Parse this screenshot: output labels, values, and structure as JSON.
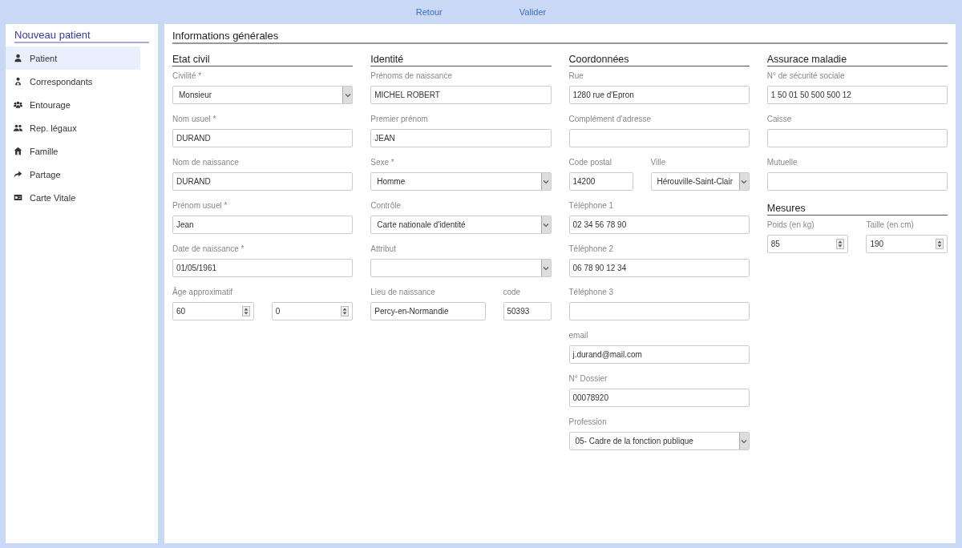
{
  "toolbar": {
    "actions": [
      "Retour",
      "Valider"
    ]
  },
  "sidebar": {
    "title": "Nouveau patient",
    "items": [
      {
        "label": "Patient",
        "kind": "person",
        "selected": true
      },
      {
        "label": "Correspondants",
        "kind": "doctor",
        "selected": false
      },
      {
        "label": "Entourage",
        "kind": "group",
        "selected": false
      },
      {
        "label": "Rep. légaux",
        "kind": "pair",
        "selected": false
      },
      {
        "label": "Famille",
        "kind": "house",
        "selected": false
      },
      {
        "label": "Partage",
        "kind": "share",
        "selected": false
      },
      {
        "label": "Carte Vitale",
        "kind": "card",
        "selected": false
      }
    ]
  },
  "main": {
    "title": "Informations générales",
    "columns": [
      {
        "sections": [
          {
            "title": "Etat civil",
            "rows": [
              [
                {
                  "kind": "select",
                  "label": "Civilité *",
                  "value": "Monsieur"
                }
              ],
              [
                {
                  "kind": "text",
                  "label": "Nom usuel *",
                  "value": "DURAND"
                }
              ],
              [
                {
                  "kind": "text",
                  "label": "Nom de naissance",
                  "value": "DURAND"
                }
              ],
              [
                {
                  "kind": "text",
                  "label": "Prénom usuel *",
                  "value": "Jean"
                }
              ],
              [
                {
                  "kind": "text",
                  "label": "Date de naissance *",
                  "value": "01/05/1961"
                }
              ],
              [
                {
                  "kind": "number",
                  "label": "Âge approximatif",
                  "value": "60"
                },
                {
                  "kind": "number",
                  "value": "0"
                }
              ]
            ]
          }
        ]
      },
      {
        "sections": [
          {
            "title": "Identité",
            "rows": [
              [
                {
                  "kind": "text",
                  "label": "Prénoms de naissance",
                  "value": "MICHEL ROBERT"
                }
              ],
              [
                {
                  "kind": "text",
                  "label": "Premier prénom",
                  "value": "JEAN"
                }
              ],
              [
                {
                  "kind": "select",
                  "label": "Sexe *",
                  "value": "Homme"
                }
              ],
              [
                {
                  "kind": "select",
                  "label": "Contrôle",
                  "value": "Carte nationale d'identité"
                }
              ],
              [
                {
                  "kind": "select",
                  "label": "Attribut"
                }
              ],
              [
                {
                  "kind": "text",
                  "label": "Lieu de naissance",
                  "value": "Percy-en-Normandie"
                },
                {
                  "kind": "text",
                  "label": "code",
                  "value": "50393"
                }
              ]
            ]
          }
        ]
      },
      {
        "sections": [
          {
            "title": "Coordonnées",
            "rows": [
              [
                {
                  "kind": "text",
                  "label": "Rue",
                  "value": "1280 rue d'Epron"
                }
              ],
              [
                {
                  "kind": "text",
                  "label": "Complément d'adresse"
                }
              ],
              [
                {
                  "kind": "text",
                  "label": "Code postal",
                  "value": "14200"
                },
                {
                  "kind": "select",
                  "label": "Ville",
                  "value": "Hérouville-Saint-Clair"
                }
              ],
              [
                {
                  "kind": "text",
                  "label": "Téléphone 1",
                  "value": "02 34 56 78 90"
                }
              ],
              [
                {
                  "kind": "text",
                  "label": "Téléphone 2",
                  "value": "06 78 90 12 34"
                }
              ],
              [
                {
                  "kind": "text",
                  "label": "Téléphone 3"
                }
              ],
              [
                {
                  "kind": "text",
                  "label": "email",
                  "value": "j.durand@mail.com"
                }
              ],
              [
                {
                  "kind": "text",
                  "label": "N° Dossier",
                  "value": "00078920"
                }
              ],
              [
                {
                  "kind": "select",
                  "label": "Profession",
                  "value": "05- Cadre de la fonction publique"
                }
              ]
            ]
          }
        ]
      },
      {
        "sections": [
          {
            "title": "Assurace maladie",
            "rows": [
              [
                {
                  "kind": "text",
                  "label": "N° de sécurité sociale",
                  "value": "1 50 01 50 500 500 12"
                }
              ],
              [
                {
                  "kind": "text",
                  "label": "Caisse"
                }
              ],
              [
                {
                  "kind": "text",
                  "label": "Mutuelle"
                }
              ]
            ]
          },
          {
            "title": "Mesures",
            "rows": [
              [
                {
                  "kind": "number",
                  "label": "Poids (en kg)",
                  "value": "85"
                },
                {
                  "kind": "number",
                  "label": "Taille (en cm)",
                  "value": "190"
                }
              ]
            ]
          }
        ]
      }
    ]
  }
}
